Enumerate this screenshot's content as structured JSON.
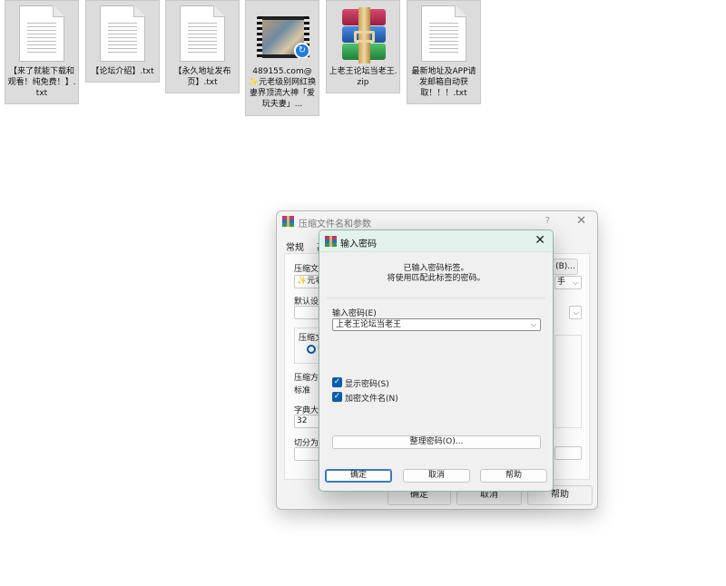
{
  "desktop": {
    "files": [
      {
        "label": "【来了就能下载和观看！纯免费！】.txt",
        "kind": "txt"
      },
      {
        "label": "【论坛介绍】.txt",
        "kind": "txt"
      },
      {
        "label": "【永久地址发布页】.txt",
        "kind": "txt"
      },
      {
        "label": "489155.com@✨元老级别网红换妻界顶流大神「爱玩夫妻」...",
        "kind": "video"
      },
      {
        "label": "上老王论坛当老王.zip",
        "kind": "rar"
      },
      {
        "label": "最新地址及APP请发邮箱自动获取！！！.txt",
        "kind": "txt"
      }
    ]
  },
  "back_dialog": {
    "title": "压缩文件名和参数",
    "help": "?",
    "close": "✕",
    "tab_general": "常规",
    "tab_advanced_partial": "高",
    "archive_name_label": "压缩文件",
    "archive_name_value": "✨元老",
    "browse_label": "(B)...",
    "update_mode_value": "手",
    "profile_label": "默认设置",
    "format_label": "压缩文",
    "format_option": "R",
    "method_label": "压缩方式",
    "method_value": "标准",
    "dict_label": "字典大小",
    "dict_value": "32",
    "split_label": "切分为分卷",
    "ok": "确定",
    "cancel": "取消",
    "help_button": "帮助"
  },
  "password_dialog": {
    "title": "输入密码",
    "close": "✕",
    "msg_line1": "已输入密码标签。",
    "msg_line2": "将使用匹配此标签的密码。",
    "password_label": "输入密码(E)",
    "password_value": "上老王论坛当老王",
    "show_password": "显示密码(S)",
    "encrypt_names": "加密文件名(N)",
    "organize": "整理密码(O)...",
    "ok": "确定",
    "cancel": "取消",
    "help": "帮助"
  },
  "colors": {
    "accent": "#0b5cad",
    "title_tint": "#e3f2ec"
  }
}
